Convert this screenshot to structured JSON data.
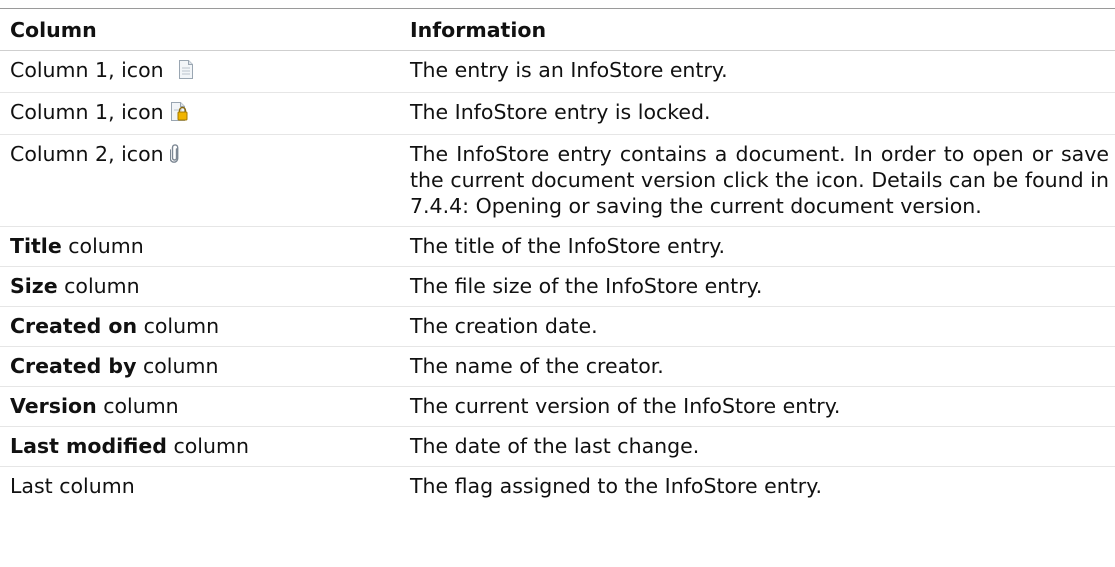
{
  "table": {
    "headers": {
      "column": "Column",
      "information": "Information"
    },
    "rows": [
      {
        "prefix": "Column 1, icon",
        "icon": "document-icon",
        "info": "The entry is an InfoStore entry."
      },
      {
        "prefix": "Column 1, icon",
        "icon": "locked-document-icon",
        "info": "The InfoStore entry is locked."
      },
      {
        "prefix": "Column 2, icon",
        "icon": "paperclip-icon",
        "info": "The InfoStore entry contains a document. In order to open or save the current document version click the icon. Details can be found in 7.4.4: Opening or saving the current document version."
      },
      {
        "keyword": "Title",
        "suffix": " column",
        "info": "The title of the InfoStore entry."
      },
      {
        "keyword": "Size",
        "suffix": " column",
        "info": "The file size of the InfoStore entry."
      },
      {
        "keyword": "Created on",
        "suffix": " column",
        "info": "The creation date."
      },
      {
        "keyword": "Created by",
        "suffix": " column",
        "info": "The name of the creator."
      },
      {
        "keyword": "Version",
        "suffix": " column",
        "info": "The current version of the InfoStore entry."
      },
      {
        "keyword": "Last modified",
        "suffix": " column",
        "info": "The date of the last change."
      },
      {
        "prefix": "Last column",
        "info": "The flag assigned to the InfoStore entry."
      }
    ]
  }
}
